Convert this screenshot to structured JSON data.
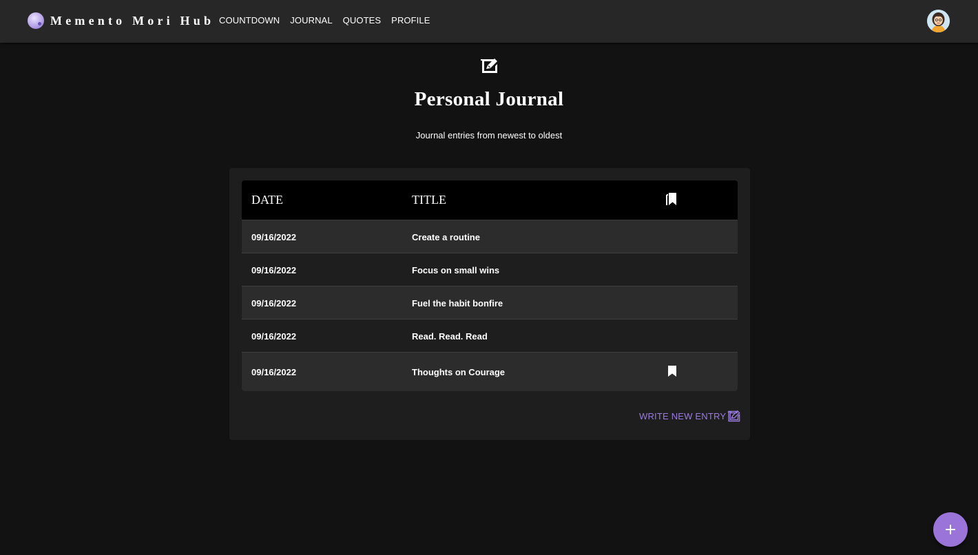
{
  "brand": {
    "name": "Memento Mori Hub",
    "logo_icon": "skull-icon"
  },
  "nav": {
    "items": [
      {
        "label": "COUNTDOWN"
      },
      {
        "label": "JOURNAL"
      },
      {
        "label": "QUOTES"
      },
      {
        "label": "PROFILE"
      }
    ]
  },
  "header": {
    "icon": "edit-note-icon",
    "title": "Personal Journal",
    "subtitle": "Journal entries from newest to oldest"
  },
  "table": {
    "columns": {
      "date": "DATE",
      "title": "TITLE",
      "bookmark_icon": "bookmarks-icon"
    },
    "rows": [
      {
        "date": "09/16/2022",
        "title": "Create a routine",
        "bookmarked": false
      },
      {
        "date": "09/16/2022",
        "title": "Focus on small wins",
        "bookmarked": false
      },
      {
        "date": "09/16/2022",
        "title": "Fuel the habit bonfire",
        "bookmarked": false
      },
      {
        "date": "09/16/2022",
        "title": "Read. Read. Read",
        "bookmarked": false
      },
      {
        "date": "09/16/2022",
        "title": "Thoughts on Courage",
        "bookmarked": true
      }
    ]
  },
  "actions": {
    "write_new_entry": "WRITE NEW ENTRY",
    "fab_icon": "plus-icon"
  },
  "colors": {
    "accent": "#9a74d8",
    "link": "#9b7be0",
    "topbar": "#272727",
    "background": "#121212"
  }
}
